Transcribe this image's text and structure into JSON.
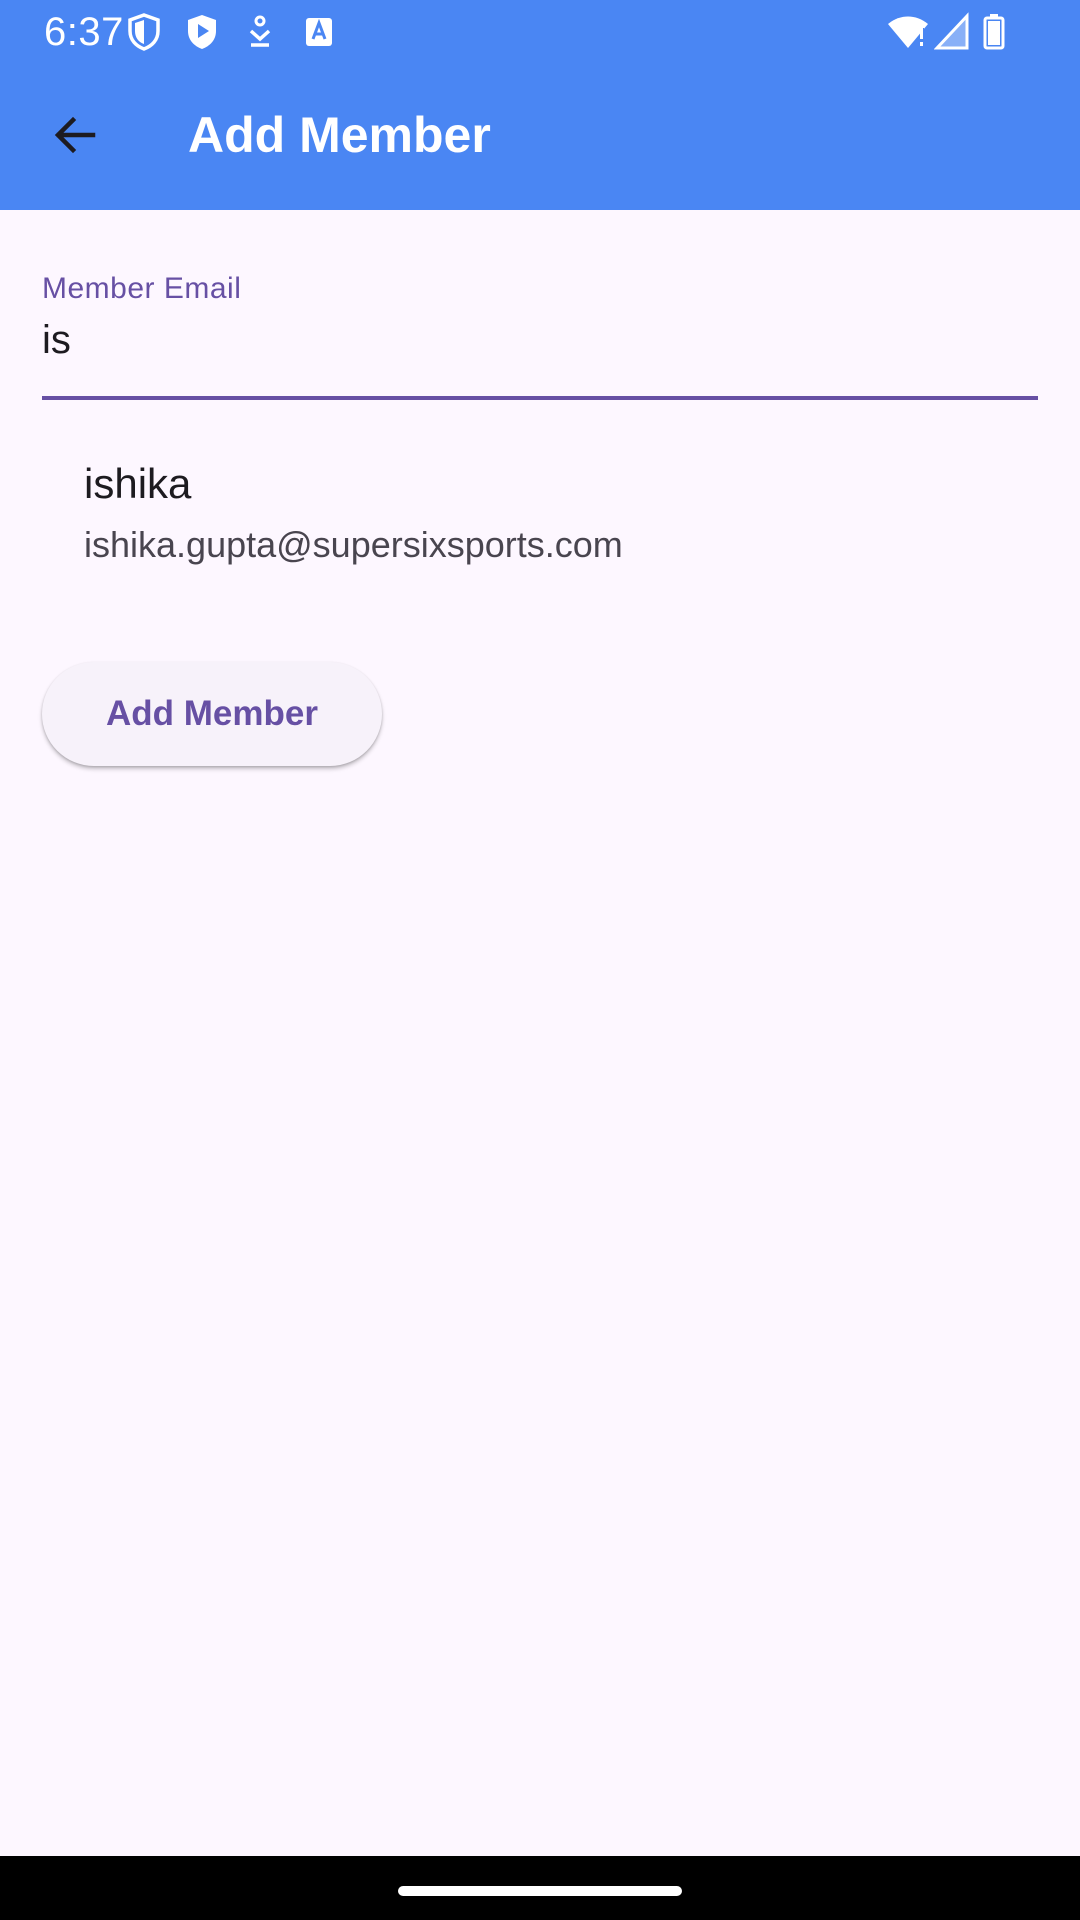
{
  "status_bar": {
    "time": "6:37",
    "left_icons": [
      "vpn-shield-icon",
      "play-protect-icon",
      "download-icon",
      "translate-icon"
    ],
    "right_icons": [
      "wifi-icon",
      "signal-icon",
      "battery-icon"
    ]
  },
  "app_bar": {
    "title": "Add Member",
    "back_icon": "arrow-left-icon"
  },
  "email_field": {
    "label": "Member Email",
    "value": "is"
  },
  "suggestions": [
    {
      "name": "ishika",
      "email": "ishika.gupta@supersixsports.com"
    }
  ],
  "add_button": {
    "label": "Add Member"
  },
  "colors": {
    "app_bar": "#4a86f3",
    "background": "#fdf7ff",
    "accent": "#6750a4",
    "button_bg": "#f7f2fa",
    "text_primary": "#1d1b20",
    "text_secondary": "#49454f"
  }
}
